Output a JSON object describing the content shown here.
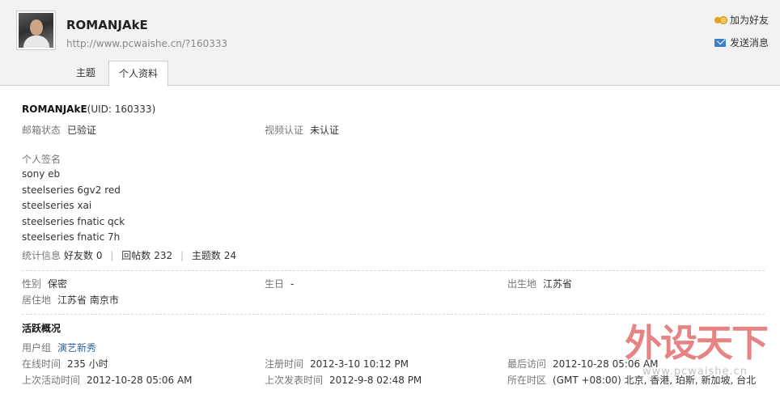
{
  "profile": {
    "username": "ROMANJAkE",
    "url": "http://www.pcwaishe.cn/?160333"
  },
  "actions": {
    "add_friend": "加为好友",
    "send_message": "发送消息"
  },
  "tabs": [
    {
      "label": "主题"
    },
    {
      "label": "个人资料"
    }
  ],
  "info": {
    "name": "ROMANJAkE",
    "uid_text": "(UID: 160333)",
    "email_status_label": "邮箱状态",
    "email_status_value": "已验证",
    "video_label": "视频认证",
    "video_value": "未认证",
    "signature_label": "个人签名",
    "signature_lines": [
      "sony eb",
      "steelseries 6gv2 red",
      "steelseries xai",
      "steelseries fnatic qck",
      "steelseries fnatic 7h"
    ],
    "stats_label": "统计信息",
    "stats": [
      {
        "label": "好友数",
        "value": "0"
      },
      {
        "label": "回帖数",
        "value": "232"
      },
      {
        "label": "主题数",
        "value": "24"
      }
    ],
    "stats_sep": "|",
    "gender_label": "性别",
    "gender_value": "保密",
    "birthday_label": "生日",
    "birthday_value": "-",
    "birthplace_label": "出生地",
    "birthplace_value": "江苏省",
    "residence_label": "居住地",
    "residence_value": "江苏省 南京市"
  },
  "activity": {
    "title": "活跃概况",
    "group_label": "用户组",
    "group_value": "演艺新秀",
    "online_label": "在线时间",
    "online_value": "235 小时",
    "register_label": "注册时间",
    "register_value": "2012-3-10 10:12 PM",
    "last_visit_label": "最后访问",
    "last_visit_value": "2012-10-28 05:06 AM",
    "last_active_label": "上次活动时间",
    "last_active_value": "2012-10-28 05:06 AM",
    "last_post_label": "上次发表时间",
    "last_post_value": "2012-9-8 02:48 PM",
    "timezone_label": "所在时区",
    "timezone_value": "(GMT +08:00) 北京, 香港, 珀斯, 新加坡, 台北"
  },
  "watermark": {
    "big": "外设天下",
    "small": "www.pcwaishe.cn"
  }
}
